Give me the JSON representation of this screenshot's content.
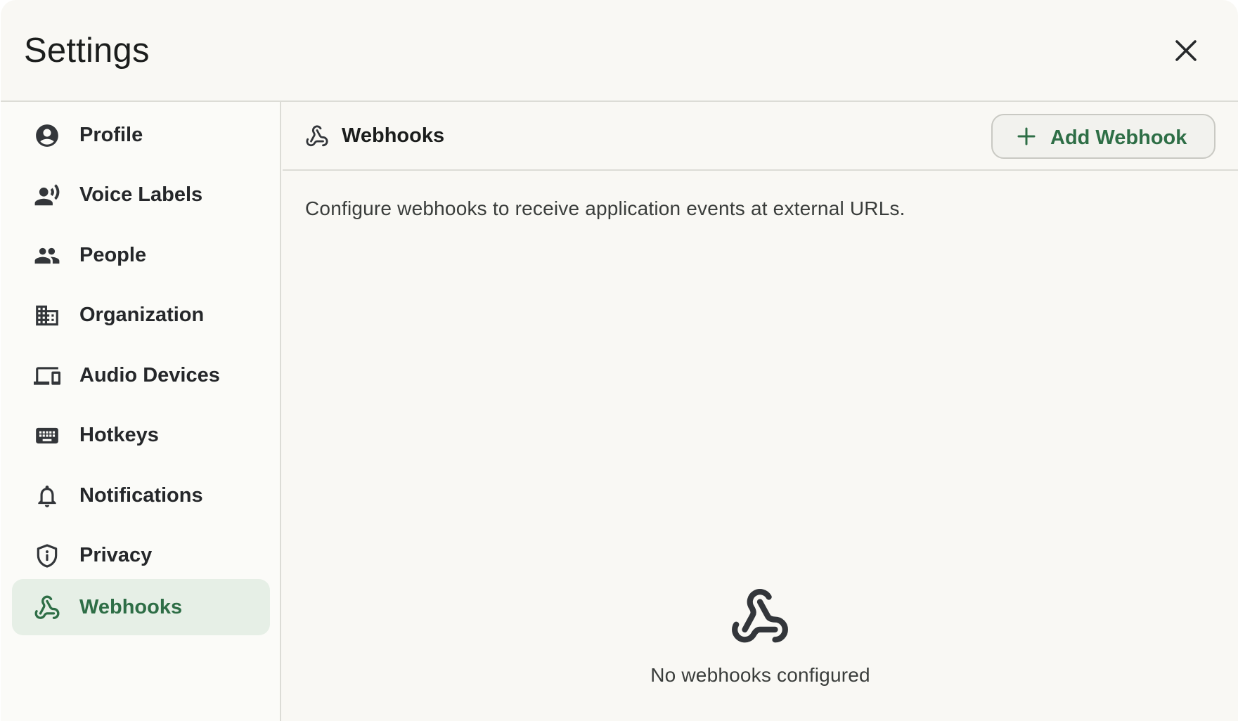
{
  "window": {
    "title": "Settings"
  },
  "colors": {
    "accent": "#2e6e46",
    "active_bg": "#e6efe6",
    "background": "#f9f8f4"
  },
  "sidebar": {
    "items": [
      {
        "label": "Profile",
        "icon": "account-circle-icon"
      },
      {
        "label": "Voice Labels",
        "icon": "record-voice-icon"
      },
      {
        "label": "People",
        "icon": "people-icon"
      },
      {
        "label": "Organization",
        "icon": "building-icon"
      },
      {
        "label": "Audio Devices",
        "icon": "devices-icon"
      },
      {
        "label": "Hotkeys",
        "icon": "keyboard-icon"
      },
      {
        "label": "Notifications",
        "icon": "bell-icon"
      },
      {
        "label": "Privacy",
        "icon": "shield-icon"
      },
      {
        "label": "Webhooks",
        "icon": "webhook-icon",
        "active": true
      }
    ]
  },
  "main": {
    "title": "Webhooks",
    "add_button_label": "Add Webhook",
    "description": "Configure webhooks to receive application events at external URLs.",
    "empty_state": "No webhooks configured"
  }
}
